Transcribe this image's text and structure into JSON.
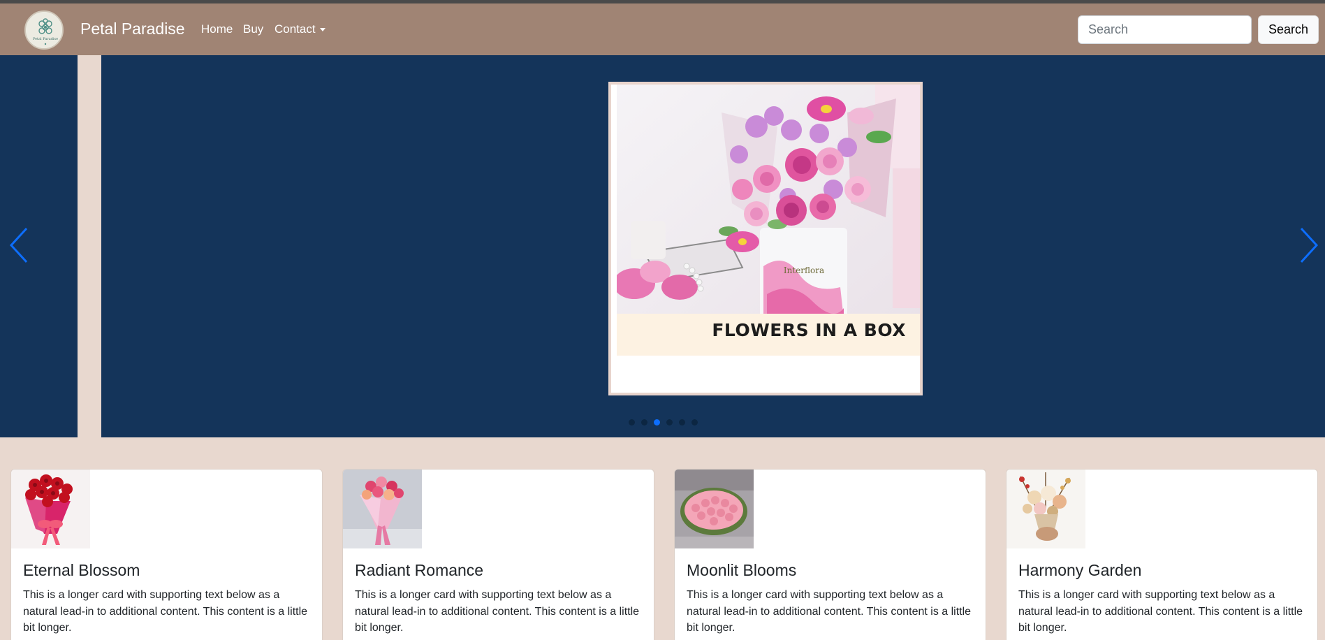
{
  "brand": {
    "name": "Petal Paradise",
    "logo_text": "Petal Paradise"
  },
  "nav": {
    "home": "Home",
    "buy": "Buy",
    "contact": "Contact"
  },
  "search": {
    "placeholder": "Search",
    "button": "Search"
  },
  "carousel": {
    "caption": "FLOWERS IN A BOX",
    "box_label": "Interflora",
    "slide_count": 6,
    "active_index": 2
  },
  "cards": [
    {
      "title": "Eternal Blossom",
      "text": "This is a longer card with supporting text below as a natural lead-in to additional content. This content is a little bit longer."
    },
    {
      "title": "Radiant Romance",
      "text": "This is a longer card with supporting text below as a natural lead-in to additional content. This content is a little bit longer."
    },
    {
      "title": "Moonlit Blooms",
      "text": "This is a longer card with supporting text below as a natural lead-in to additional content. This content is a little bit longer."
    },
    {
      "title": "Harmony Garden",
      "text": "This is a longer card with supporting text below as a natural lead-in to additional content. This content is a little bit longer."
    }
  ],
  "icons": {
    "prev": "chevron-left-icon",
    "next": "chevron-right-icon",
    "dropdown": "caret-down-icon"
  },
  "colors": {
    "navbar": "#a08474",
    "carousel_bg": "#14345a",
    "page_bg": "#e8d8cf",
    "accent": "#0d6efd"
  }
}
